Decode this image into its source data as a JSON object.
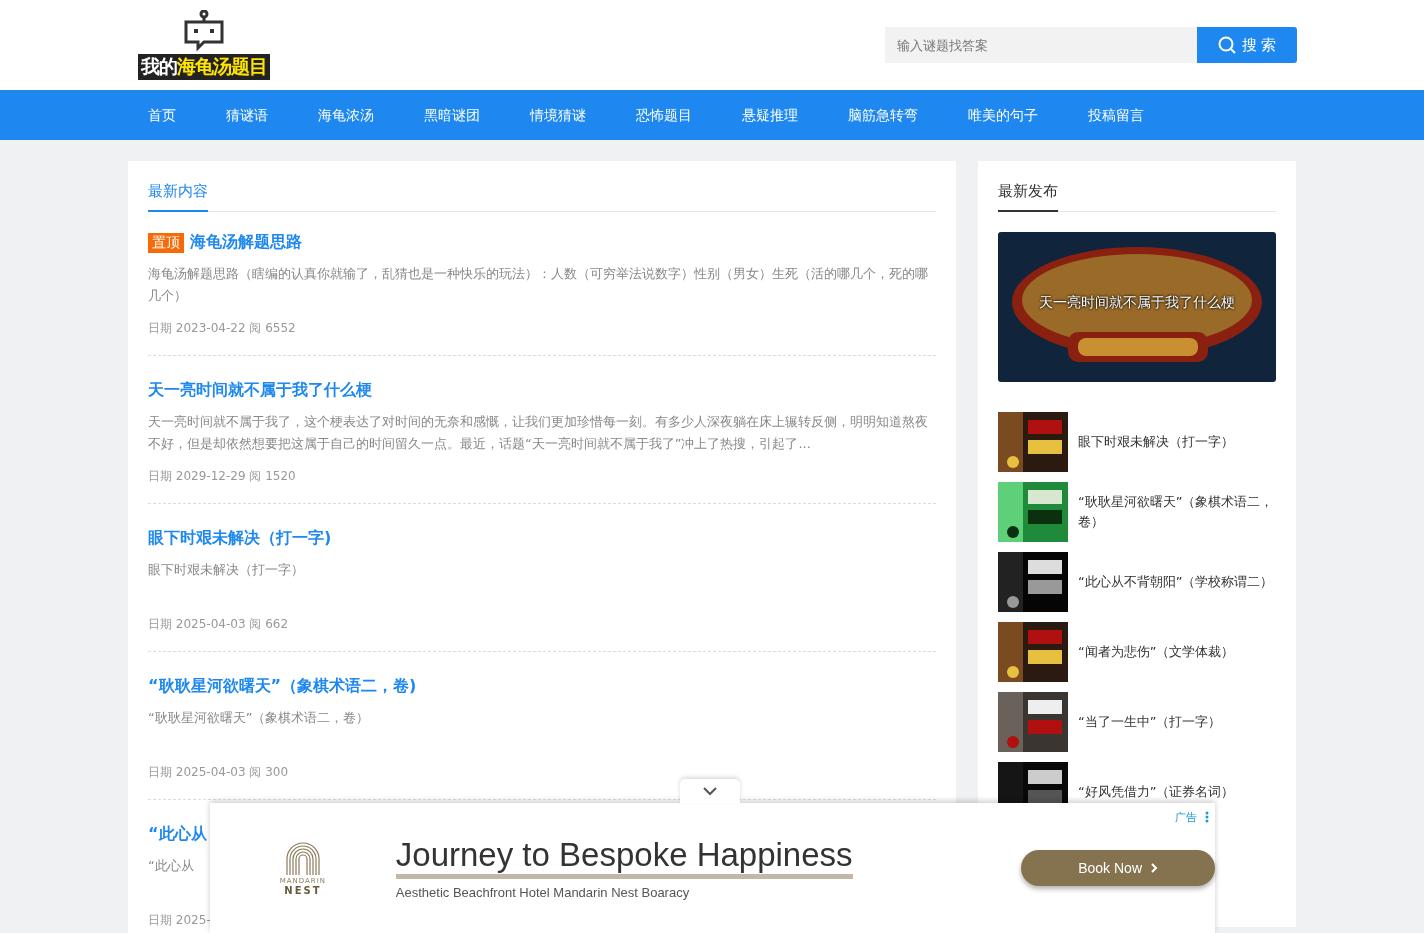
{
  "logo": {
    "text_plain": "我的",
    "text_highlight": "海龟汤题目"
  },
  "search": {
    "placeholder": "输入谜题找答案",
    "button": "搜 索"
  },
  "nav": [
    {
      "label": "首页"
    },
    {
      "label": "猜谜语"
    },
    {
      "label": "海龟浓汤"
    },
    {
      "label": "黑暗谜团"
    },
    {
      "label": "情境猜谜"
    },
    {
      "label": "恐怖题目"
    },
    {
      "label": "悬疑推理"
    },
    {
      "label": "脑筋急转弯"
    },
    {
      "label": "唯美的句子"
    },
    {
      "label": "投稿留言"
    }
  ],
  "latest": {
    "title": "最新内容",
    "articles": [
      {
        "badge": "置顶",
        "title": "海龟汤解题思路",
        "summary": "海龟汤解题思路（瞎编的认真你就输了，乱猜也是一种快乐的玩法）：人数（可穷举法说数字）性别（男女）生死（活的哪几个，死的哪几个）",
        "date": "日期 2023-04-22",
        "views": "阅 6552"
      },
      {
        "title": "天一亮时间就不属于我了什么梗",
        "summary": "天一亮时间就不属于我了，这个梗表达了对时间的无奈和感慨，让我们更加珍惜每一刻。有多少人深夜躺在床上辗转反侧，明明知道熬夜不好，但是却依然想要把这属于自己的时间留久一点。最近，话题“天一亮时间就不属于我了”冲上了热搜，引起了...",
        "date": "日期 2029-12-29",
        "views": "阅 1520"
      },
      {
        "title": "眼下时艰未解决（打一字)",
        "summary": "眼下时艰未解决（打一字）",
        "date": "日期 2025-04-03",
        "views": "阅 662"
      },
      {
        "title": "“耿耿星河欲曙天”（象棋术语二，卷)",
        "summary": "“耿耿星河欲曙天”（象棋术语二，卷）",
        "date": "日期 2025-04-03",
        "views": "阅 300"
      },
      {
        "title": "“此心从",
        "summary": "“此心从",
        "date": "日期 2025-"
      }
    ]
  },
  "recent": {
    "title": "最新发布",
    "featured": {
      "caption": "天一亮时间就不属于我了什么梗"
    },
    "items": [
      {
        "text": "眼下时艰未解决（打一字）"
      },
      {
        "text": "“耿耿星河欲曙天”（象棋术语二，卷）"
      },
      {
        "text": "“此心从不背朝阳”（学校称谓二）"
      },
      {
        "text": "“闻者为悲伤”（文学体裁）"
      },
      {
        "text": "“当了一生中”（打一字）"
      },
      {
        "text": "“好风凭借力”（证券名词）"
      }
    ]
  },
  "ad": {
    "label": "广告",
    "brand_top": "MANDARIN",
    "brand_name": "NEST",
    "headline": "Journey to Bespoke Happiness",
    "subline": "Aesthetic Beachfront Hotel Mandarin Nest Boaracy",
    "cta": "Book Now"
  }
}
